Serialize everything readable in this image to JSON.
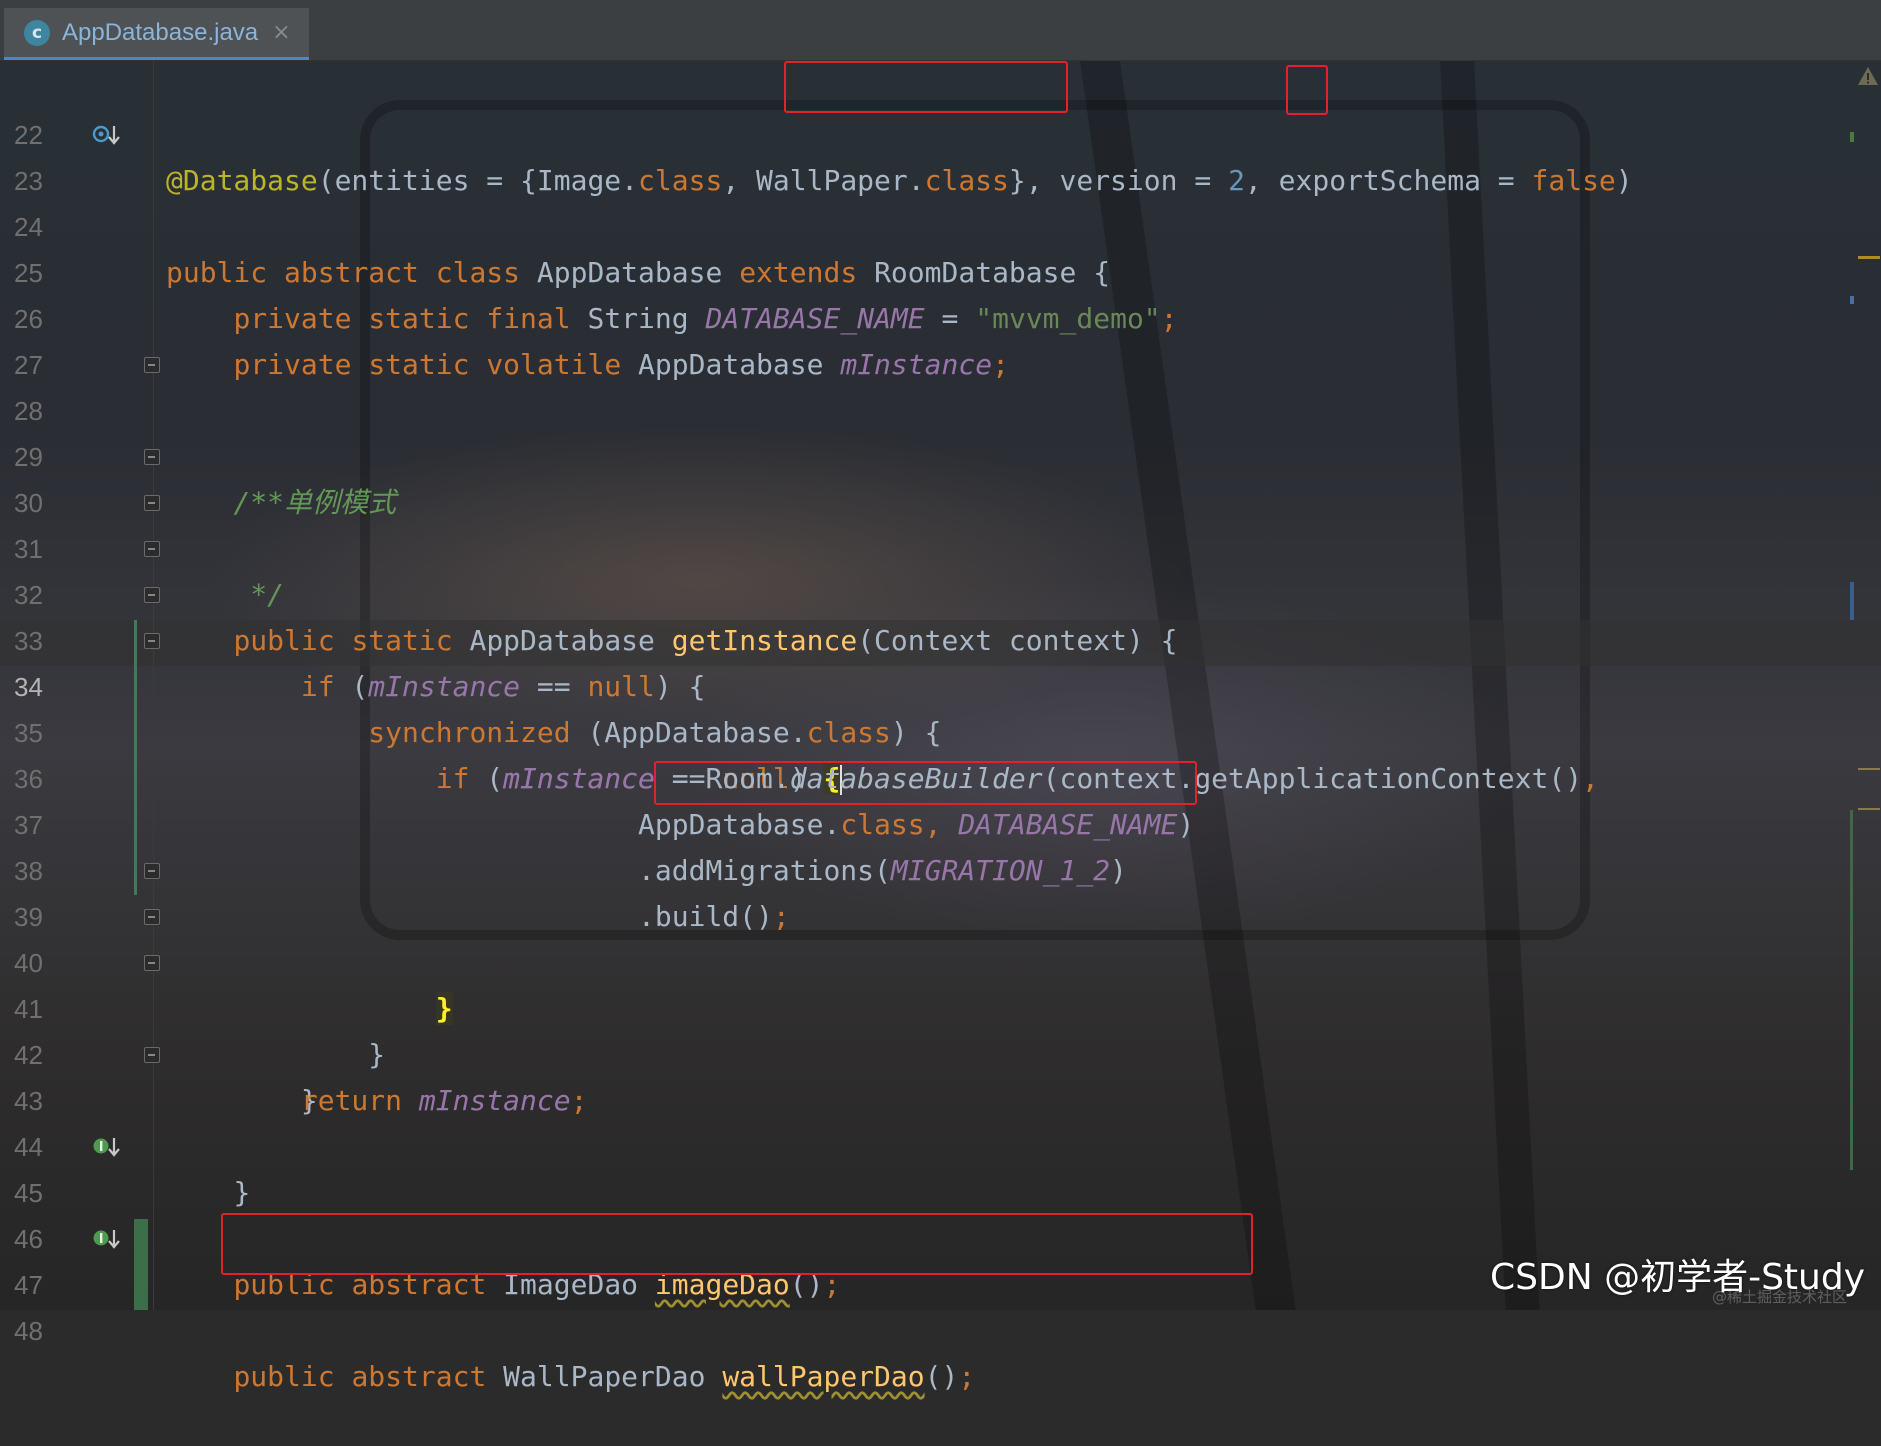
{
  "tab": {
    "icon_letter": "c",
    "file_name": "AppDatabase.java",
    "close_glyph": "×"
  },
  "line_numbers": [
    "22",
    "23",
    "24",
    "25",
    "26",
    "27",
    "28",
    "29",
    "30",
    "31",
    "32",
    "33",
    "34",
    "35",
    "36",
    "37",
    "38",
    "39",
    "40",
    "41",
    "42",
    "43",
    "44",
    "45",
    "46",
    "47",
    "48"
  ],
  "current_line": "34",
  "code": {
    "l22": {
      "annotation": "@Database",
      "t1": "(entities = {Image.",
      "kw1": "class",
      "t2": ", ",
      "t3": "WallPaper.",
      "kw2": "class",
      "t4": "}, version = ",
      "num": "2",
      "t5": ", exportSchema = ",
      "kw3": "false",
      "t6": ")"
    },
    "l23": {
      "kw1": "public",
      "kw2": "abstract",
      "kw3": "class",
      "name": "AppDatabase",
      "kw4": "extends",
      "base": "RoomDatabase",
      "t1": " {"
    },
    "l25": {
      "kw1": "private",
      "kw2": "static",
      "kw3": "final",
      "type": "String",
      "field": "DATABASE_NAME",
      "eq": " = ",
      "str": "\"mvvm_demo\"",
      "semi": ";"
    },
    "l26": {
      "kw1": "private",
      "kw2": "static",
      "kw3": "volatile",
      "type": "AppDatabase",
      "field": "mInstance",
      "semi": ";"
    },
    "l28": {
      "comment": "/**"
    },
    "l29": {
      "comment": " * 单例模式"
    },
    "l30": {
      "comment": " */"
    },
    "l31": {
      "kw1": "public",
      "kw2": "static",
      "type": "AppDatabase",
      "method": "getInstance",
      "params": "(Context context) {"
    },
    "l32": {
      "kw": "if",
      "t1": " (",
      "field": "mInstance",
      "t2": " == ",
      "kw2": "null",
      "t3": ") {"
    },
    "l33": {
      "kw": "synchronized",
      "t1": " (AppDatabase.",
      "kw2": "class",
      "t2": ") {"
    },
    "l34": {
      "kw": "if",
      "t1": " (",
      "field": "mInstance",
      "t2": " == ",
      "kw2": "null",
      "t3": ") ",
      "brace": "{"
    },
    "l35": {
      "field": "mInstance",
      "t1": " = Room.",
      "method": "databaseBuilder",
      "t2": "(context.getApplicationContext()",
      "comma": ","
    },
    "l36": {
      "t1": "AppDatabase.",
      "kw": "class",
      "comma": ", ",
      "field": "DATABASE_NAME",
      "t2": ")"
    },
    "l37": {
      "t1": ".addMigrations(",
      "field": "MIGRATION_1_2",
      "t2": ")"
    },
    "l38": {
      "t1": ".build()",
      "semi": ";"
    },
    "l39": {
      "brace": "}"
    },
    "l40": {
      "t1": "}"
    },
    "l41": {
      "t1": "}"
    },
    "l42": {
      "kw": "return",
      "field": "mInstance",
      "semi": ";"
    },
    "l43": {
      "t1": "}"
    },
    "l45": {
      "kw1": "public",
      "kw2": "abstract",
      "type": "ImageDao",
      "method": "imageDao",
      "t1": "()",
      "semi": ";"
    },
    "l47": {
      "kw1": "public",
      "kw2": "abstract",
      "type": "WallPaperDao",
      "method": "wallPaperDao",
      "t1": "()",
      "semi": ";"
    }
  },
  "watermark": "CSDN @初学者-Study",
  "watermark_faint": "@稀土掘金技术社区",
  "colors": {
    "keyword": "#cc7832",
    "annotation": "#bbb529",
    "string": "#6a8759",
    "comment": "#629755",
    "field": "#9876aa",
    "method": "#ffc66d",
    "number": "#6897bb",
    "highlight_box": "#e0232a"
  }
}
